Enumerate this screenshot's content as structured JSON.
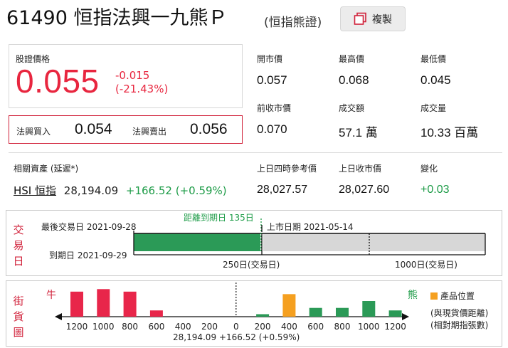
{
  "header": {
    "code": "61490",
    "name": "恒指法興一九熊Ｐ",
    "type": "(恒指熊證)",
    "copy_label": "複製"
  },
  "price": {
    "label": "股證價格",
    "value": "0.055",
    "change": "-0.015",
    "change_pct": "(-21.43%)"
  },
  "bid_ask": {
    "bid_label": "法興買入",
    "bid": "0.054",
    "ask_label": "法興賣出",
    "ask": "0.056"
  },
  "stats": [
    {
      "label": "開市價",
      "value": "0.057"
    },
    {
      "label": "最高價",
      "value": "0.068"
    },
    {
      "label": "最低價",
      "value": "0.045"
    },
    {
      "label": "前收市價",
      "value": "0.070"
    },
    {
      "label": "成交額",
      "value": "57.1 萬"
    },
    {
      "label": "成交量",
      "value": "10.33 百萬"
    }
  ],
  "related": {
    "header": "相關資產 (延遲*)",
    "name": "HSI 恒指",
    "price": "28,194.09",
    "change": "+166.52 (+0.59%)",
    "ref_label": "上日四時參考價",
    "ref_value": "28,027.57",
    "close_label": "上日收市價",
    "close_value": "28,027.60",
    "diff_label": "變化",
    "diff_value": "+0.03"
  },
  "trading_days": {
    "side_title": [
      "交",
      "易",
      "日"
    ],
    "last_trade_label": "最後交易日 2021-09-28",
    "days_to_expiry": "距離到期日 135日",
    "listing_label": "上市日期 2021-05-14",
    "expiry_label": "到期日 2021-09-29",
    "scale_250": "250日(交易日)",
    "scale_1000": "1000日(交易日)",
    "elapsed_fraction": 0.35,
    "colors": {
      "elapsed": "#2b9a57",
      "remaining": "#d7d7d7"
    }
  },
  "street": {
    "side_title": [
      "街",
      "貨",
      "圖"
    ],
    "bull_label": "牛",
    "bear_label": "熊",
    "legend_label": "產品位置",
    "note_line1": "(與現貨價距離)",
    "note_line2": "(相對期指張數)",
    "center_value": "28,194.09 +166.52 (+0.59%)",
    "colors": {
      "bull": "#e8264a",
      "bear": "#2b9a57",
      "product": "#f5a020",
      "bull_text": "#d1213a",
      "bear_text": "#1e9c48"
    }
  },
  "chart_data": {
    "type": "bar",
    "categories": [
      "1200",
      "1000",
      "800",
      "600",
      "400",
      "200",
      "0",
      "200",
      "400",
      "600",
      "800",
      "1000",
      "1200"
    ],
    "series": [
      {
        "name": "牛",
        "values": [
          40,
          44,
          40,
          10,
          0,
          0,
          0,
          0,
          0,
          0,
          0,
          0,
          0
        ]
      },
      {
        "name": "熊",
        "values": [
          0,
          0,
          0,
          0,
          0,
          0,
          0,
          4,
          36,
          14,
          14,
          25,
          10
        ]
      }
    ],
    "product_position_index": 8,
    "ylim": [
      0,
      50
    ],
    "grid": false
  }
}
